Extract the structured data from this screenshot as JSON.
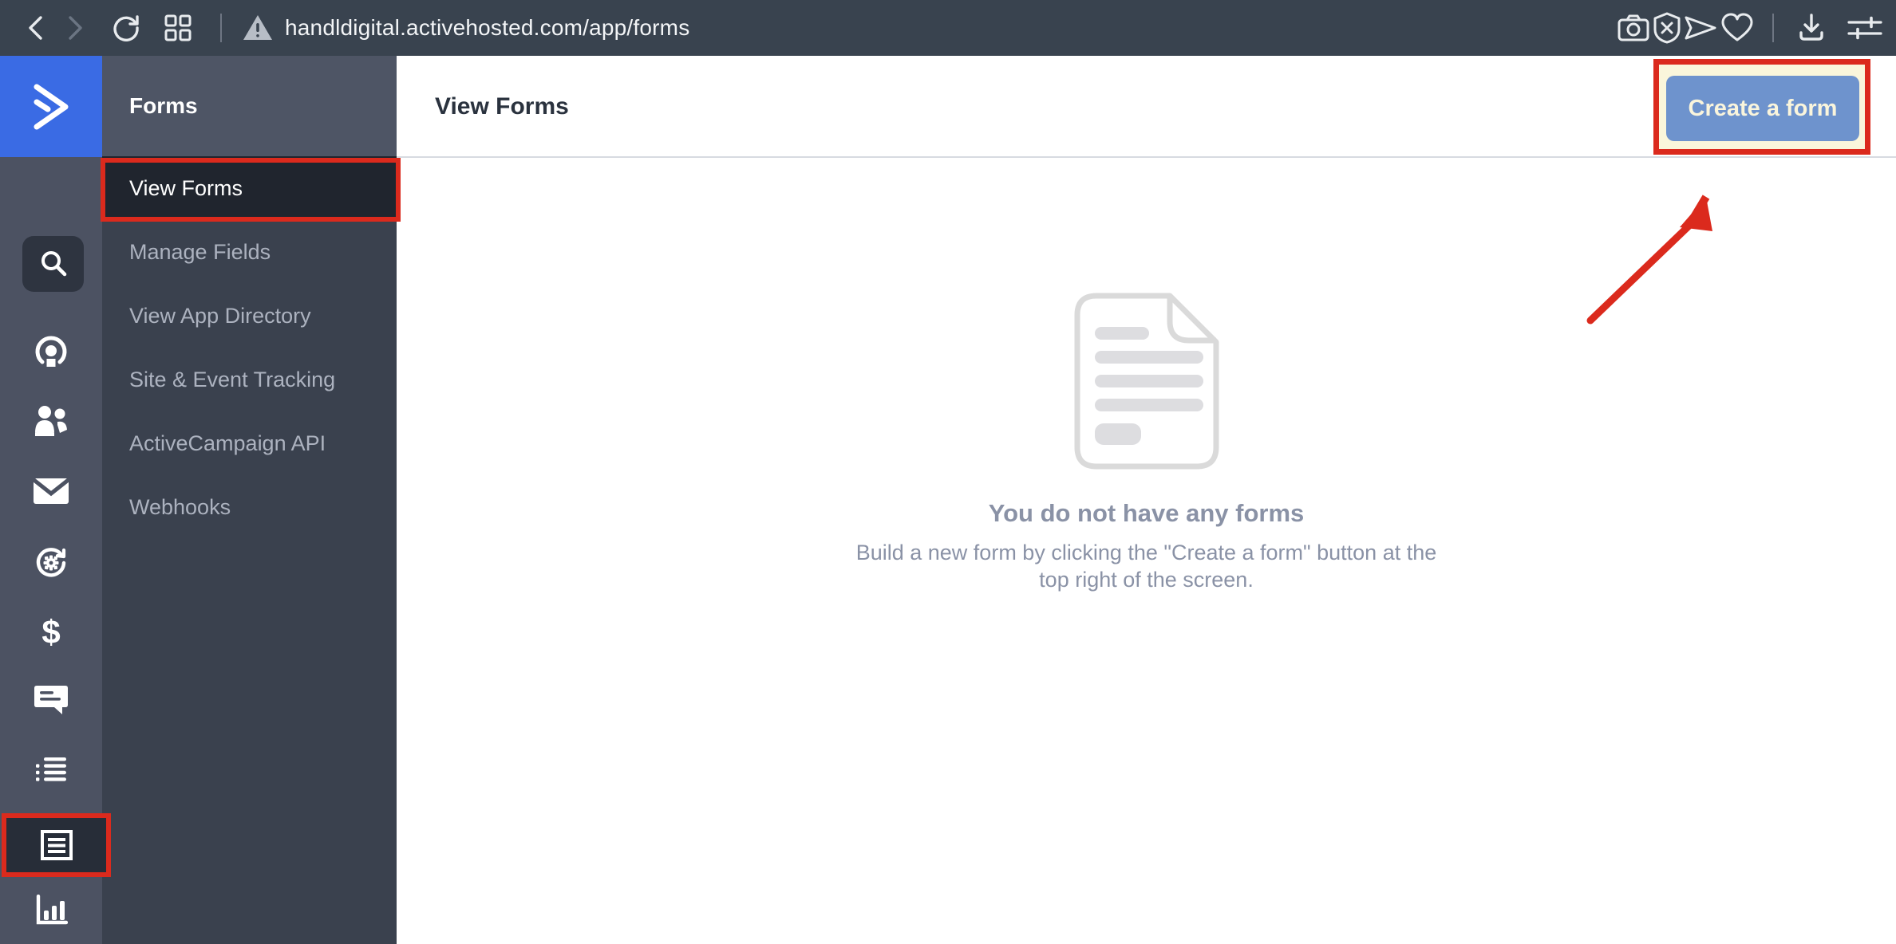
{
  "colors": {
    "toolbar_bg": "#39434F",
    "iconbar_bg": "#4C5262",
    "logo_blue": "#3A6BE4",
    "sidebar_bg": "#3A414E",
    "sidebar_head_bg": "#4E5565",
    "active_item_bg": "#20252E",
    "annotation_red": "#DB2A1D",
    "annotation_cream": "#FAF6DB",
    "button_blue": "#6E93CD",
    "empty_text_gray": "#8A92A6"
  },
  "browser": {
    "url": "handldigital.activehosted.com/app/forms",
    "left_icons": [
      "back-icon",
      "forward-icon",
      "reload-icon",
      "tab-grid-icon",
      "warning-triangle-icon"
    ],
    "right_icons": [
      "camera-icon",
      "shield-block-icon",
      "send-icon",
      "heart-icon",
      "download-icon",
      "preferences-icon"
    ]
  },
  "icon_sidebar": {
    "logo": "activecampaign-logo",
    "items": [
      "search-icon",
      "contacts-icon",
      "audiences-icon",
      "campaigns-mail-icon",
      "automations-icon",
      "deals-dollar-icon",
      "conversations-icon",
      "lists-icon",
      "forms-icon",
      "reports-icon"
    ],
    "active_item": "forms-icon",
    "dollar_glyph": "$"
  },
  "sidebar": {
    "title": "Forms",
    "items": [
      {
        "label": "View Forms",
        "active": true
      },
      {
        "label": "Manage Fields",
        "active": false
      },
      {
        "label": "View App Directory",
        "active": false
      },
      {
        "label": "Site & Event Tracking",
        "active": false
      },
      {
        "label": "ActiveCampaign API",
        "active": false
      },
      {
        "label": "Webhooks",
        "active": false
      }
    ]
  },
  "main": {
    "title": "View Forms",
    "create_button_label": "Create a form",
    "empty": {
      "heading": "You do not have any forms",
      "body_line1": "Build a new form by clicking the \"Create a form\" button at",
      "body_line2": "the top right of the screen."
    }
  }
}
